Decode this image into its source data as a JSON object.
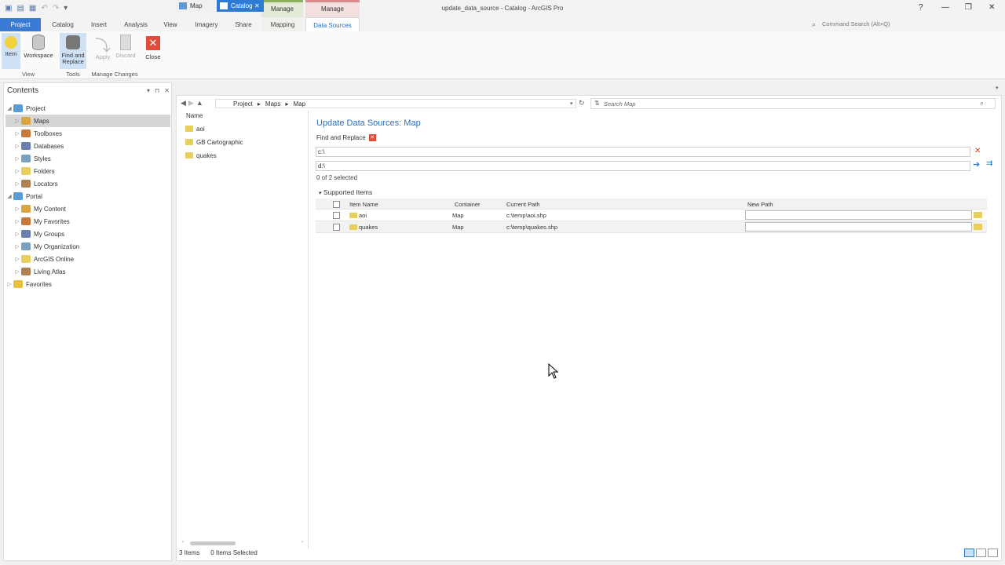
{
  "window": {
    "title": "update_data_source - Catalog - ArcGIS Pro",
    "command_search_placeholder": "Command Search (Alt+Q)",
    "help": "?",
    "minimize": "—",
    "restore": "❐",
    "close": "✕"
  },
  "contextual": {
    "group1": "Manage",
    "group2": "Manage"
  },
  "tabs": {
    "project": "Project",
    "catalog": "Catalog",
    "insert": "Insert",
    "analysis": "Analysis",
    "view": "View",
    "imagery": "Imagery",
    "share": "Share",
    "mapping": "Mapping",
    "data_sources": "Data Sources"
  },
  "ribbon": {
    "item": "Item",
    "workspace": "Workspace",
    "find_replace_1": "Find and",
    "find_replace_2": "Replace",
    "apply": "Apply",
    "discard": "Discard",
    "close": "Close",
    "group_view": "View",
    "group_tools": "Tools",
    "group_manage": "Manage Changes"
  },
  "contents": {
    "title": "Contents",
    "items": [
      {
        "label": "Project",
        "indent": 0,
        "expanded": true
      },
      {
        "label": "Maps",
        "indent": 1,
        "selected": true
      },
      {
        "label": "Toolboxes",
        "indent": 1
      },
      {
        "label": "Databases",
        "indent": 1
      },
      {
        "label": "Styles",
        "indent": 1
      },
      {
        "label": "Folders",
        "indent": 1
      },
      {
        "label": "Locators",
        "indent": 1
      },
      {
        "label": "Portal",
        "indent": 0,
        "expanded": true
      },
      {
        "label": "My Content",
        "indent": 1
      },
      {
        "label": "My Favorites",
        "indent": 1
      },
      {
        "label": "My Groups",
        "indent": 1
      },
      {
        "label": "My Organization",
        "indent": 1
      },
      {
        "label": "ArcGIS Online",
        "indent": 1
      },
      {
        "label": "Living Atlas",
        "indent": 1
      },
      {
        "label": "Favorites",
        "indent": 0
      }
    ]
  },
  "view_tabs": {
    "map": "Map",
    "catalog": "Catalog"
  },
  "breadcrumb": [
    "Project",
    "Maps",
    "Map"
  ],
  "search_placeholder": "Search Map",
  "list": {
    "header": "Name",
    "items": [
      "aoi",
      "GB Cartographic",
      "quakes"
    ]
  },
  "update": {
    "title": "Update Data Sources: Map",
    "find_replace_label": "Find and Replace",
    "find_value": "c:\\",
    "replace_value": "d:\\",
    "selected_count": "0 of 2 selected",
    "supported_items": "Supported Items",
    "columns": [
      "Item Name",
      "Container",
      "Current Path",
      "New Path"
    ],
    "rows": [
      {
        "name": "aoi",
        "container": "Map",
        "path": "c:\\temp\\aoi.shp"
      },
      {
        "name": "quakes",
        "container": "Map",
        "path": "c:\\temp\\quakes.shp"
      }
    ]
  },
  "status": {
    "items": "3 Items",
    "selected": "0 Items Selected"
  }
}
